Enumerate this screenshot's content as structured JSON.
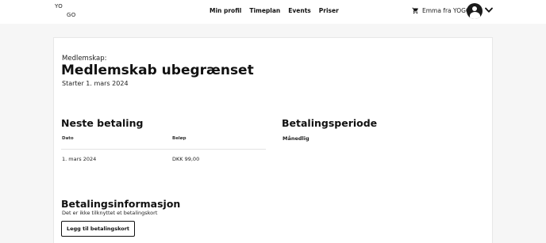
{
  "header": {
    "logo": {
      "line1": "YO",
      "line2": "GO"
    },
    "nav": [
      "Min profil",
      "Timeplan",
      "Events",
      "Priser"
    ],
    "cart_icon": "cart-icon",
    "user_name": "Emma fra YOGO",
    "avatar_icon": "account-circle-icon",
    "menu_icon": "chevron-down-icon"
  },
  "membership": {
    "label": "Medlemskap:",
    "title": "Medlemskab ubegrænset",
    "start": "Starter 1. mars 2024"
  },
  "next_payment": {
    "heading": "Neste betaling",
    "columns": [
      "Dato",
      "Beløp"
    ],
    "rows": [
      {
        "date": "1. mars 2024",
        "amount": "DKK 99,00"
      }
    ]
  },
  "payment_period": {
    "heading": "Betalingsperiode",
    "value": "Månedlig"
  },
  "payment_info": {
    "heading": "Betalingsinformasjon",
    "subtext": "Det er ikke tilknyttet et betalingskort",
    "button_label": "Legg til betalingskort"
  }
}
